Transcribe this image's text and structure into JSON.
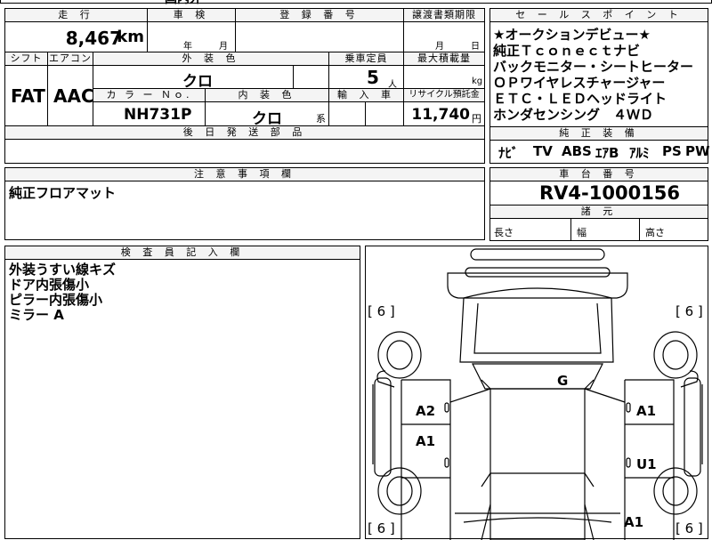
{
  "top_fragment": {
    "text": "国内外"
  },
  "mileage": {
    "label": "走 行",
    "value": "8,467",
    "unit": "km"
  },
  "shaken": {
    "label": "車 検",
    "year_unit": "年",
    "month_unit": "月"
  },
  "registration": {
    "label": "登 録 番 号"
  },
  "transfer_deadline": {
    "label": "譲渡書類期限",
    "month_unit": "月",
    "day_unit": "日"
  },
  "shift": {
    "label": "シフト",
    "value": "FAT"
  },
  "aircon": {
    "label": "エアコン",
    "value": "AAC"
  },
  "exterior_color": {
    "label": "外 装 色",
    "value": "クロ"
  },
  "capacity": {
    "label": "乗車定員",
    "value": "5",
    "unit": "人"
  },
  "max_load": {
    "label": "最大積載量",
    "unit": "kg"
  },
  "color_no": {
    "label": "カ ラ ー Ｎｏ.",
    "value": "NH731P"
  },
  "interior_color": {
    "label": "内 装 色",
    "value": "クロ",
    "suffix": "系"
  },
  "import": {
    "label": "輸 入 車"
  },
  "recycle": {
    "label": "リサイクル預託金",
    "value": "11,740",
    "unit": "円"
  },
  "later_parts": {
    "label": "後 日 発 送 部 品"
  },
  "notes": {
    "label": "注 意 事 項 欄",
    "text": "純正フロアマット"
  },
  "inspector": {
    "label": "検 査 員 記 入 欄",
    "lines": [
      "外装うすい線キズ",
      "ドア内張傷小",
      "ピラー内張傷小",
      "ミラー A"
    ]
  },
  "sales_points": {
    "label": "セ ー ル ス ポ イ ン ト",
    "lines": [
      "★オークションデビュー★",
      "純正Ｔｃｏｎｅｃｔナビ",
      "バックモニター・シートヒーター",
      "ＯＰワイヤレスチャージャー",
      "ＥＴＣ・ＬＥＤヘッドライト",
      "ホンダセンシング　４ＷＤ"
    ]
  },
  "equipment": {
    "label": "純 正 装 備",
    "items": [
      "ﾅﾋﾞ",
      "TV",
      "ABS",
      "ｴｱB",
      "ｱﾙﾐ",
      "PS",
      "PW"
    ]
  },
  "chassis": {
    "label": "車 台 番 号",
    "value": "RV4-1000156"
  },
  "dimensions": {
    "label": "諸 元",
    "length": "長さ",
    "width": "幅",
    "height": "高さ"
  },
  "diagram": {
    "tire_marks": [
      "[ 6 ]",
      "[ 6 ]",
      "[ 6 ]",
      "[ 6 ]"
    ],
    "marks": [
      "G",
      "A2",
      "A1",
      "A1",
      "U1",
      "A1"
    ]
  }
}
